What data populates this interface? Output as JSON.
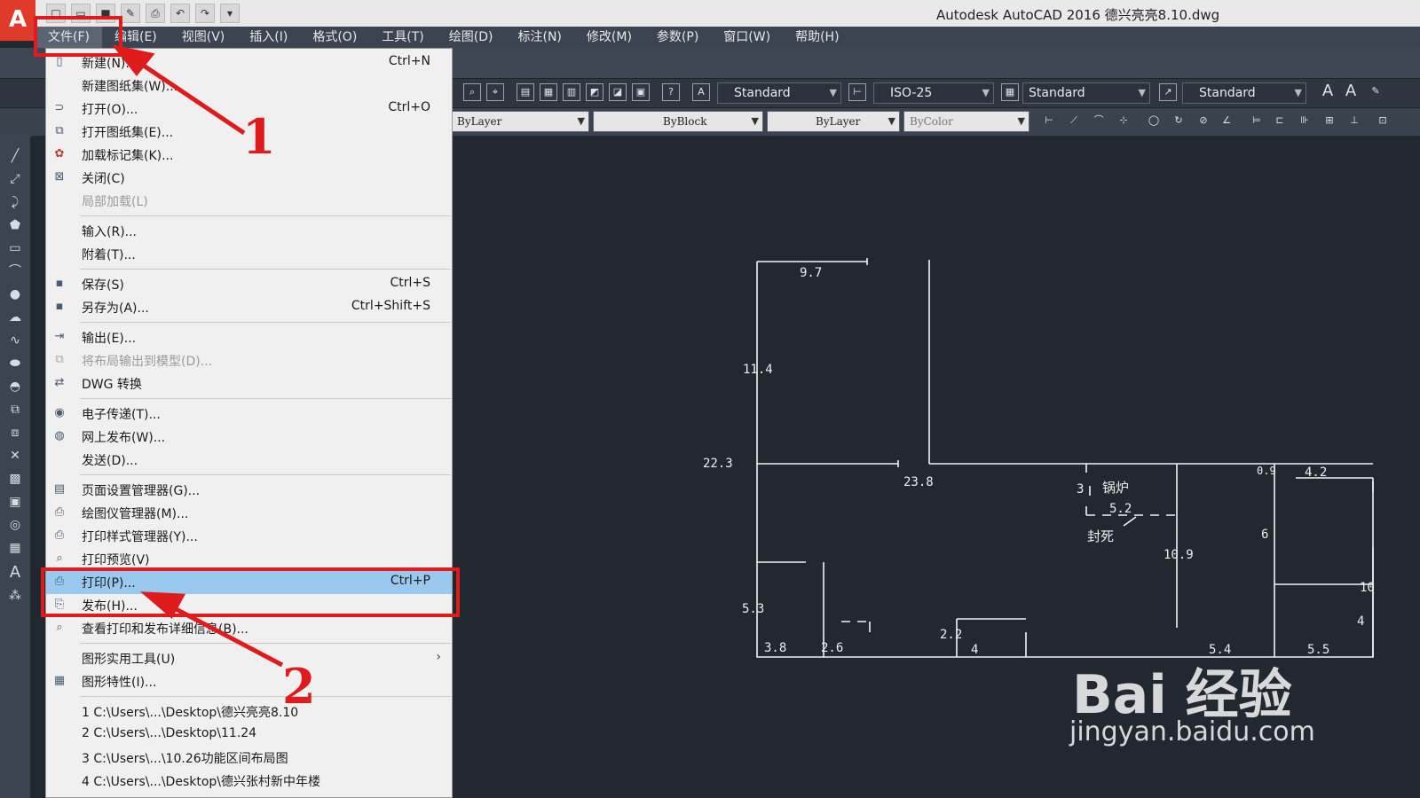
{
  "window": {
    "title": "Autodesk AutoCAD 2016    德兴亮亮8.10.dwg",
    "logo_letter": "A"
  },
  "menubar": {
    "items": [
      "文件(F)",
      "编辑(E)",
      "视图(V)",
      "插入(I)",
      "格式(O)",
      "工具(T)",
      "绘图(D)",
      "标注(N)",
      "修改(M)",
      "参数(P)",
      "窗口(W)",
      "帮助(H)"
    ]
  },
  "styles_toolbar": {
    "text_style": "Standard",
    "dim_style": "ISO-25",
    "table_style": "Standard",
    "multileader_style": "Standard"
  },
  "properties_toolbar": {
    "layer_color": "ByLayer",
    "linetype": "ByBlock",
    "lineweight": "ByLayer",
    "plot_style": "ByColor"
  },
  "file_menu": {
    "items": [
      {
        "label": "新建(N)...",
        "shortcut": "Ctrl+N",
        "icon": "new-file-icon"
      },
      {
        "label": "新建图纸集(W)...",
        "shortcut": "",
        "icon": ""
      },
      {
        "label": "打开(O)...",
        "shortcut": "Ctrl+O",
        "icon": "open-folder-icon"
      },
      {
        "label": "打开图纸集(E)...",
        "shortcut": "",
        "icon": "open-sheet-set-icon"
      },
      {
        "label": "加载标记集(K)...",
        "shortcut": "",
        "icon": "markup-set-icon"
      },
      {
        "label": "关闭(C)",
        "shortcut": "",
        "icon": "close-file-icon"
      },
      {
        "label": "局部加载(L)",
        "shortcut": "",
        "icon": "",
        "disabled": true
      },
      {
        "label": "输入(R)...",
        "shortcut": "",
        "icon": ""
      },
      {
        "label": "附着(T)...",
        "shortcut": "",
        "icon": ""
      },
      {
        "label": "保存(S)",
        "shortcut": "Ctrl+S",
        "icon": "save-icon"
      },
      {
        "label": "另存为(A)...",
        "shortcut": "Ctrl+Shift+S",
        "icon": "save-as-icon"
      },
      {
        "label": "输出(E)...",
        "shortcut": "",
        "icon": "export-icon"
      },
      {
        "label": "将布局输出到模型(D)...",
        "shortcut": "",
        "icon": "layout-export-icon",
        "disabled": true
      },
      {
        "label": "DWG 转换",
        "shortcut": "",
        "icon": "dwg-convert-icon"
      },
      {
        "label": "电子传递(T)...",
        "shortcut": "",
        "icon": "etransmit-icon"
      },
      {
        "label": "网上发布(W)...",
        "shortcut": "",
        "icon": "publish-web-icon"
      },
      {
        "label": "发送(D)...",
        "shortcut": "",
        "icon": ""
      },
      {
        "label": "页面设置管理器(G)...",
        "shortcut": "",
        "icon": "page-setup-icon"
      },
      {
        "label": "绘图仪管理器(M)...",
        "shortcut": "",
        "icon": "plotter-icon"
      },
      {
        "label": "打印样式管理器(Y)...",
        "shortcut": "",
        "icon": "plot-style-icon"
      },
      {
        "label": "打印预览(V)",
        "shortcut": "",
        "icon": "plot-preview-icon"
      },
      {
        "label": "打印(P)...",
        "shortcut": "Ctrl+P",
        "icon": "printer-icon",
        "highlighted": true
      },
      {
        "label": "发布(H)...",
        "shortcut": "",
        "icon": "publish-icon"
      },
      {
        "label": "查看打印和发布详细信息(B)...",
        "shortcut": "",
        "icon": "plot-details-icon"
      },
      {
        "label": "图形实用工具(U)",
        "shortcut": "",
        "icon": "",
        "submenu": true
      },
      {
        "label": "图形特性(I)...",
        "shortcut": "",
        "icon": "drawing-properties-icon"
      },
      {
        "label": "1 C:\\Users\\...\\Desktop\\德兴亮亮8.10",
        "shortcut": "",
        "icon": ""
      },
      {
        "label": "2 C:\\Users\\...\\Desktop\\11.24",
        "shortcut": "",
        "icon": ""
      },
      {
        "label": "3 C:\\Users\\...\\10.26功能区间布局图",
        "shortcut": "",
        "icon": ""
      },
      {
        "label": "4 C:\\Users\\...\\Desktop\\德兴张村新中年楼",
        "shortcut": "",
        "icon": ""
      }
    ],
    "submenu_arrow": "›"
  },
  "annotations": {
    "step1": "1",
    "step2": "2",
    "color": "#e01b1b"
  },
  "drawing": {
    "dimensions": [
      "9.7",
      "11.4",
      "22.3",
      "23.8",
      "3",
      "锅炉",
      "5.2",
      "封死",
      "0.9",
      "4.2",
      "6",
      "10.9",
      "10",
      "5.3",
      "3.8",
      "2.6",
      "2.2",
      "4",
      "5.4",
      "5.5",
      "4"
    ]
  },
  "watermark": {
    "brand": "Bai 经验",
    "url": "jingyan.baidu.com"
  }
}
